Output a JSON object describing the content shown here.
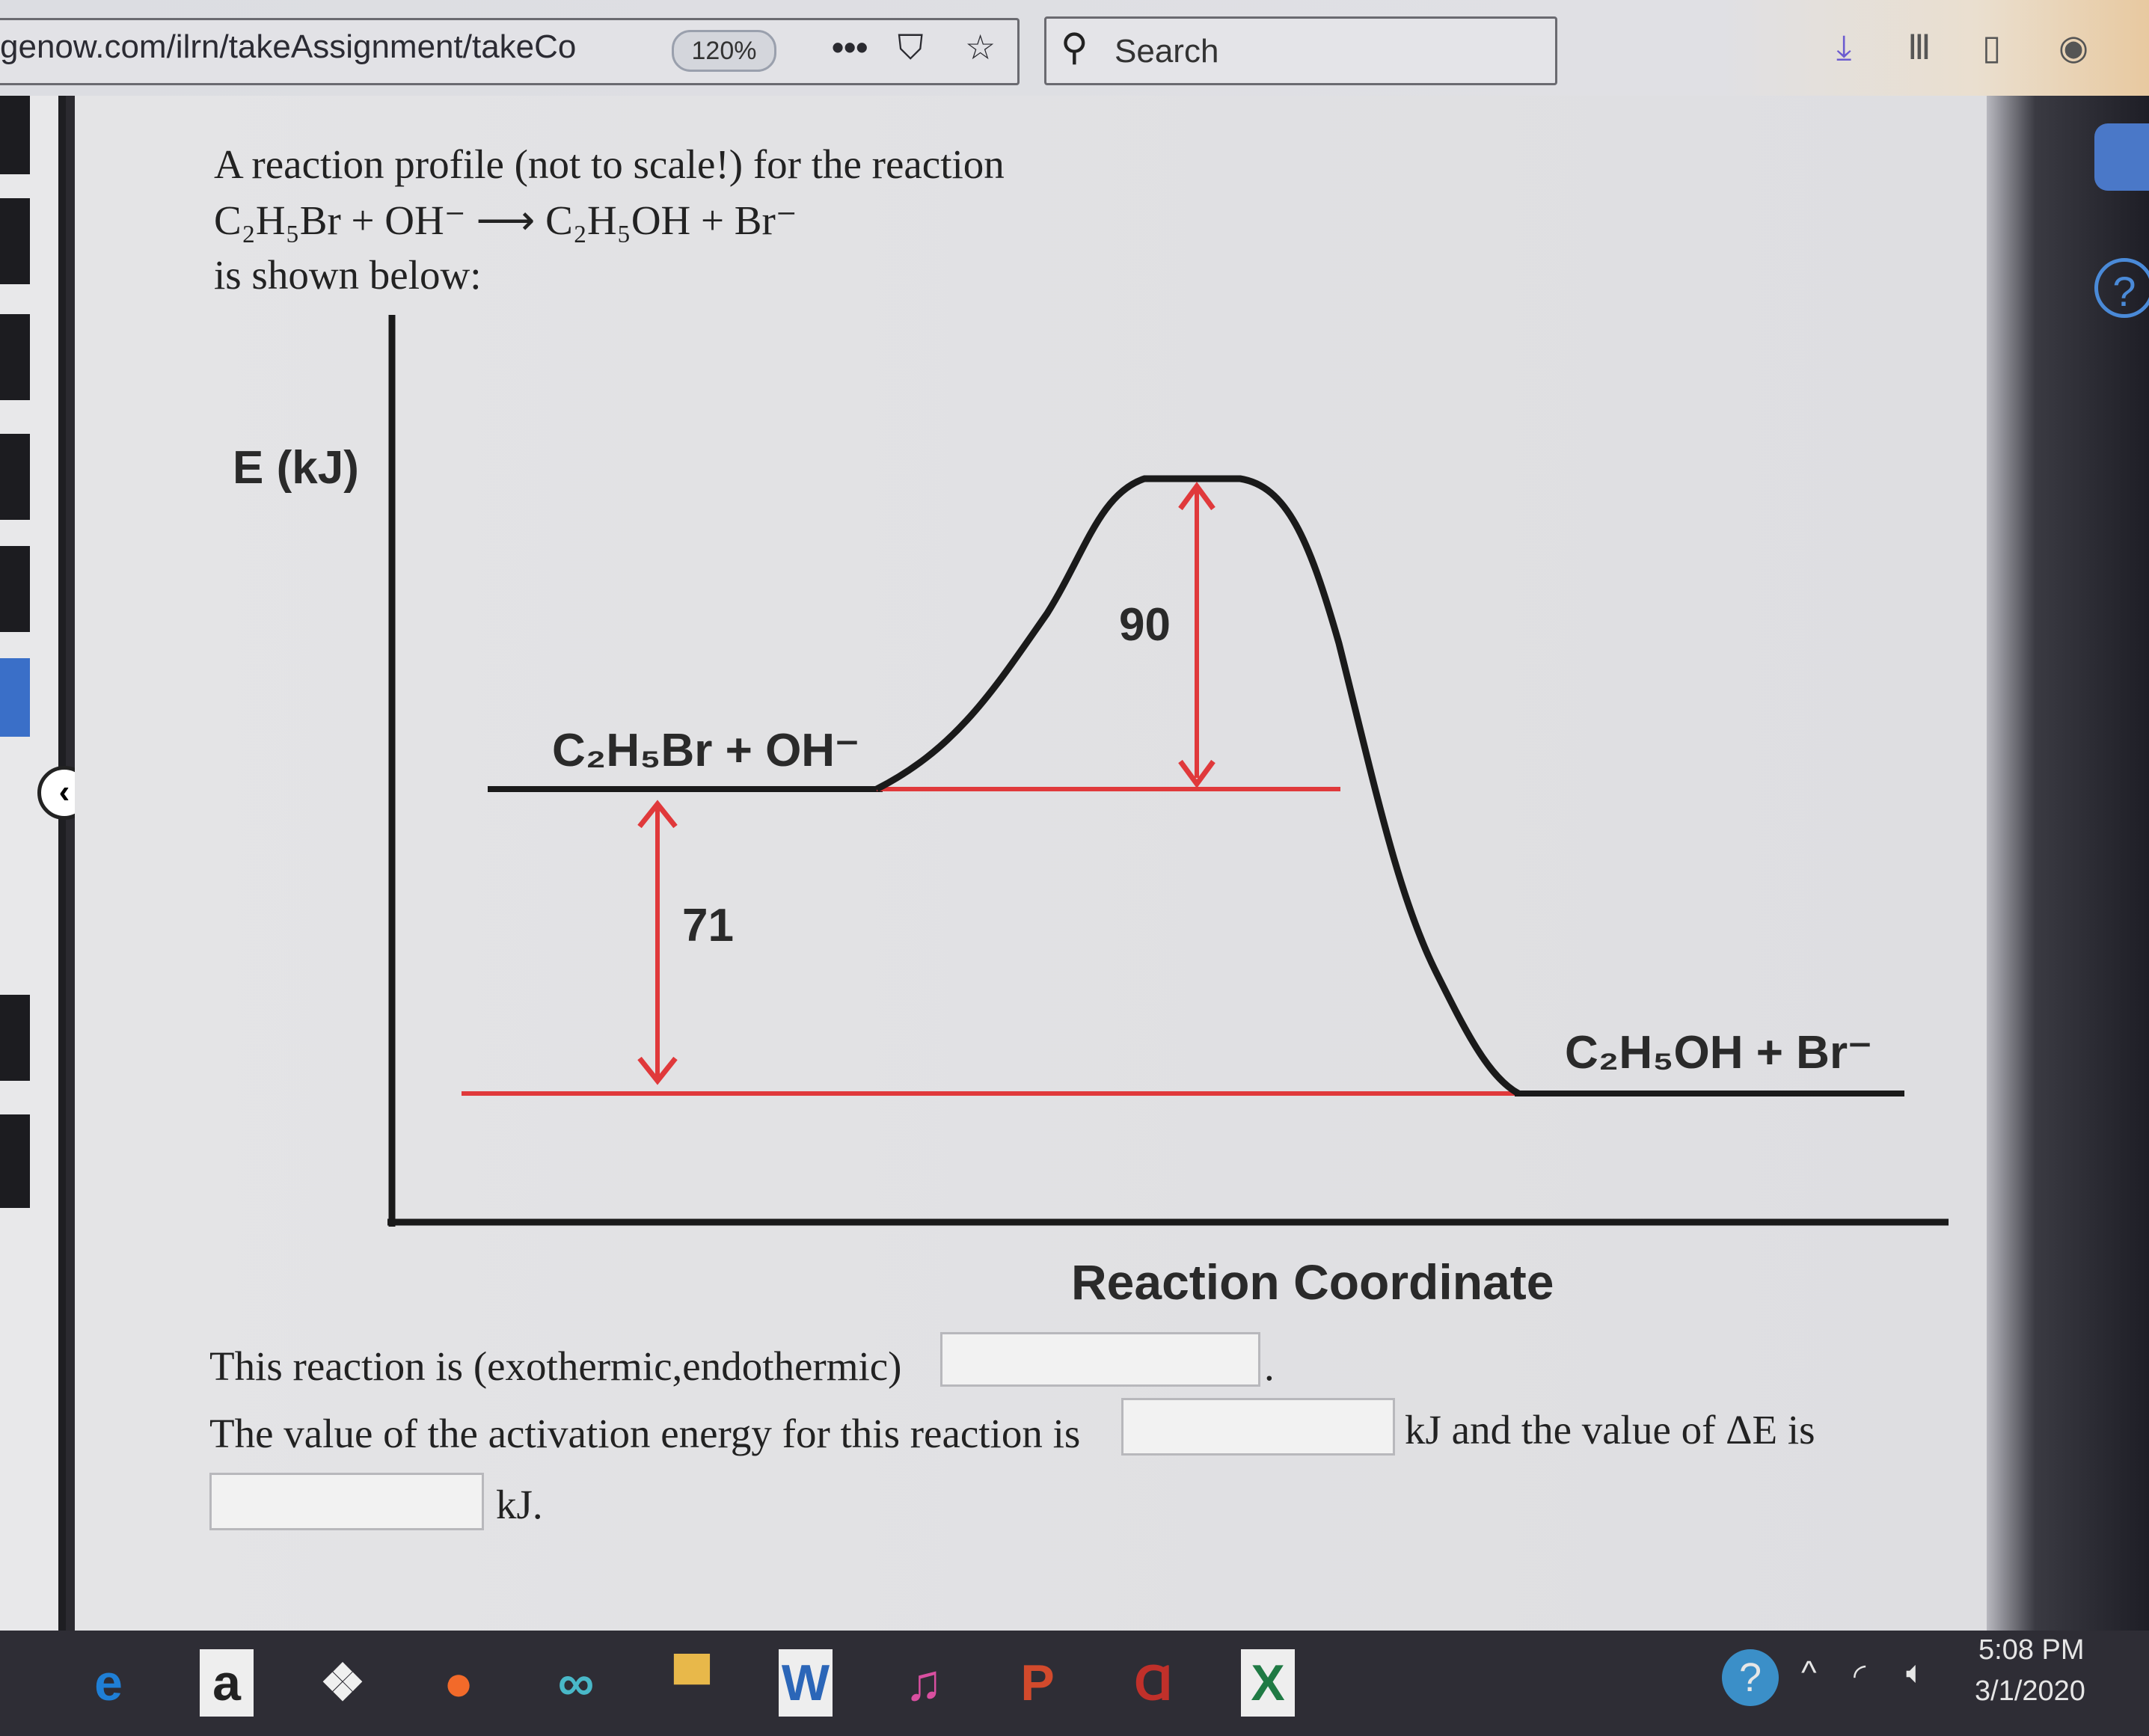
{
  "browser": {
    "url": "genow.com/ilrn/takeAssignment/takeCo",
    "zoom": "120%",
    "search_placeholder": "Search",
    "icons": [
      "more-dots-icon",
      "pocket-icon",
      "bookmark-star-icon",
      "search-icon",
      "download-icon",
      "library-icon",
      "sidebar-icon",
      "account-icon"
    ]
  },
  "question": {
    "intro_line1": "A reaction profile (not to scale!) for the reaction",
    "equation": "C₂H₅Br + OH⁻ ⟶ C₂H₅OH + Br⁻",
    "intro_line3": "is shown below:",
    "q1_text": "This reaction is (exothermic,endothermic)",
    "q1_end": ".",
    "q2_text": "The value of the activation energy for this reaction is",
    "q2_after": "kJ and the value of ΔE is",
    "q3_after": "kJ.",
    "answers": {
      "type": "",
      "activation_energy": "",
      "delta_e": ""
    }
  },
  "diagram": {
    "ylabel": "E (kJ)",
    "xlabel": "Reaction Coordinate",
    "reactants_label": "C₂H₅Br + OH⁻",
    "products_label": "C₂H₅OH + Br⁻",
    "activation_label": "90",
    "delta_label": "71",
    "colors": {
      "curve": "#1a1a1a",
      "guides": "#e0393b"
    }
  },
  "taskbar": {
    "apps": [
      {
        "name": "edge",
        "glyph": "e",
        "color": "#1f7fd6"
      },
      {
        "name": "amazon",
        "glyph": "a",
        "color": "#222"
      },
      {
        "name": "dropbox",
        "glyph": "❖",
        "color": "#f0f0f0"
      },
      {
        "name": "firefox",
        "glyph": "●",
        "color": "#f26a2a"
      },
      {
        "name": "infinity",
        "glyph": "∞",
        "color": "#49b8c8"
      },
      {
        "name": "file-explorer",
        "glyph": "▀",
        "color": "#e8b84a"
      },
      {
        "name": "word",
        "glyph": "W",
        "color": "#2b66b8"
      },
      {
        "name": "itunes",
        "glyph": "♫",
        "color": "#d94fa0"
      },
      {
        "name": "powerpoint",
        "glyph": "P",
        "color": "#d24a2c"
      },
      {
        "name": "acrobat",
        "glyph": "Ɑ",
        "color": "#c0302a"
      },
      {
        "name": "excel",
        "glyph": "X",
        "color": "#1f7a44"
      }
    ],
    "time": "5:08 PM",
    "date": "3/1/2020"
  }
}
